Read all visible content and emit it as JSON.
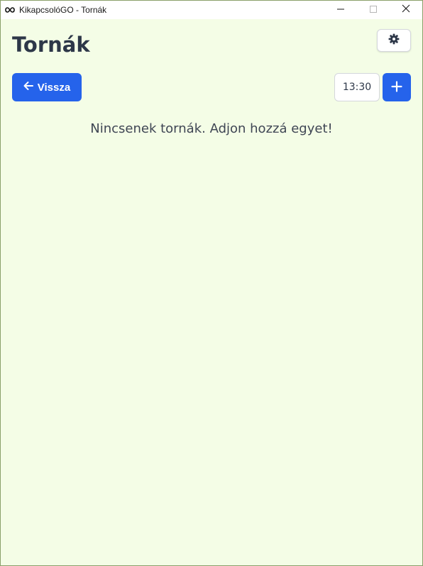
{
  "window": {
    "title": "KikapcsolóGO - Tornák",
    "icon": "infinity-icon",
    "controls": [
      "minimize-icon",
      "maximize-icon",
      "close-icon"
    ]
  },
  "header": {
    "title": "Tornák",
    "settings_icon": "gear-icon"
  },
  "toolbar": {
    "back_label": "Vissza",
    "back_icon": "arrow-left-icon",
    "time": "13:30",
    "add_icon": "plus-icon"
  },
  "main": {
    "empty_message": "Nincsenek tornák. Adjon hozzá egyet!"
  },
  "colors": {
    "background": "#f4fde6",
    "primary": "#2563eb",
    "text": "#2d3748"
  }
}
